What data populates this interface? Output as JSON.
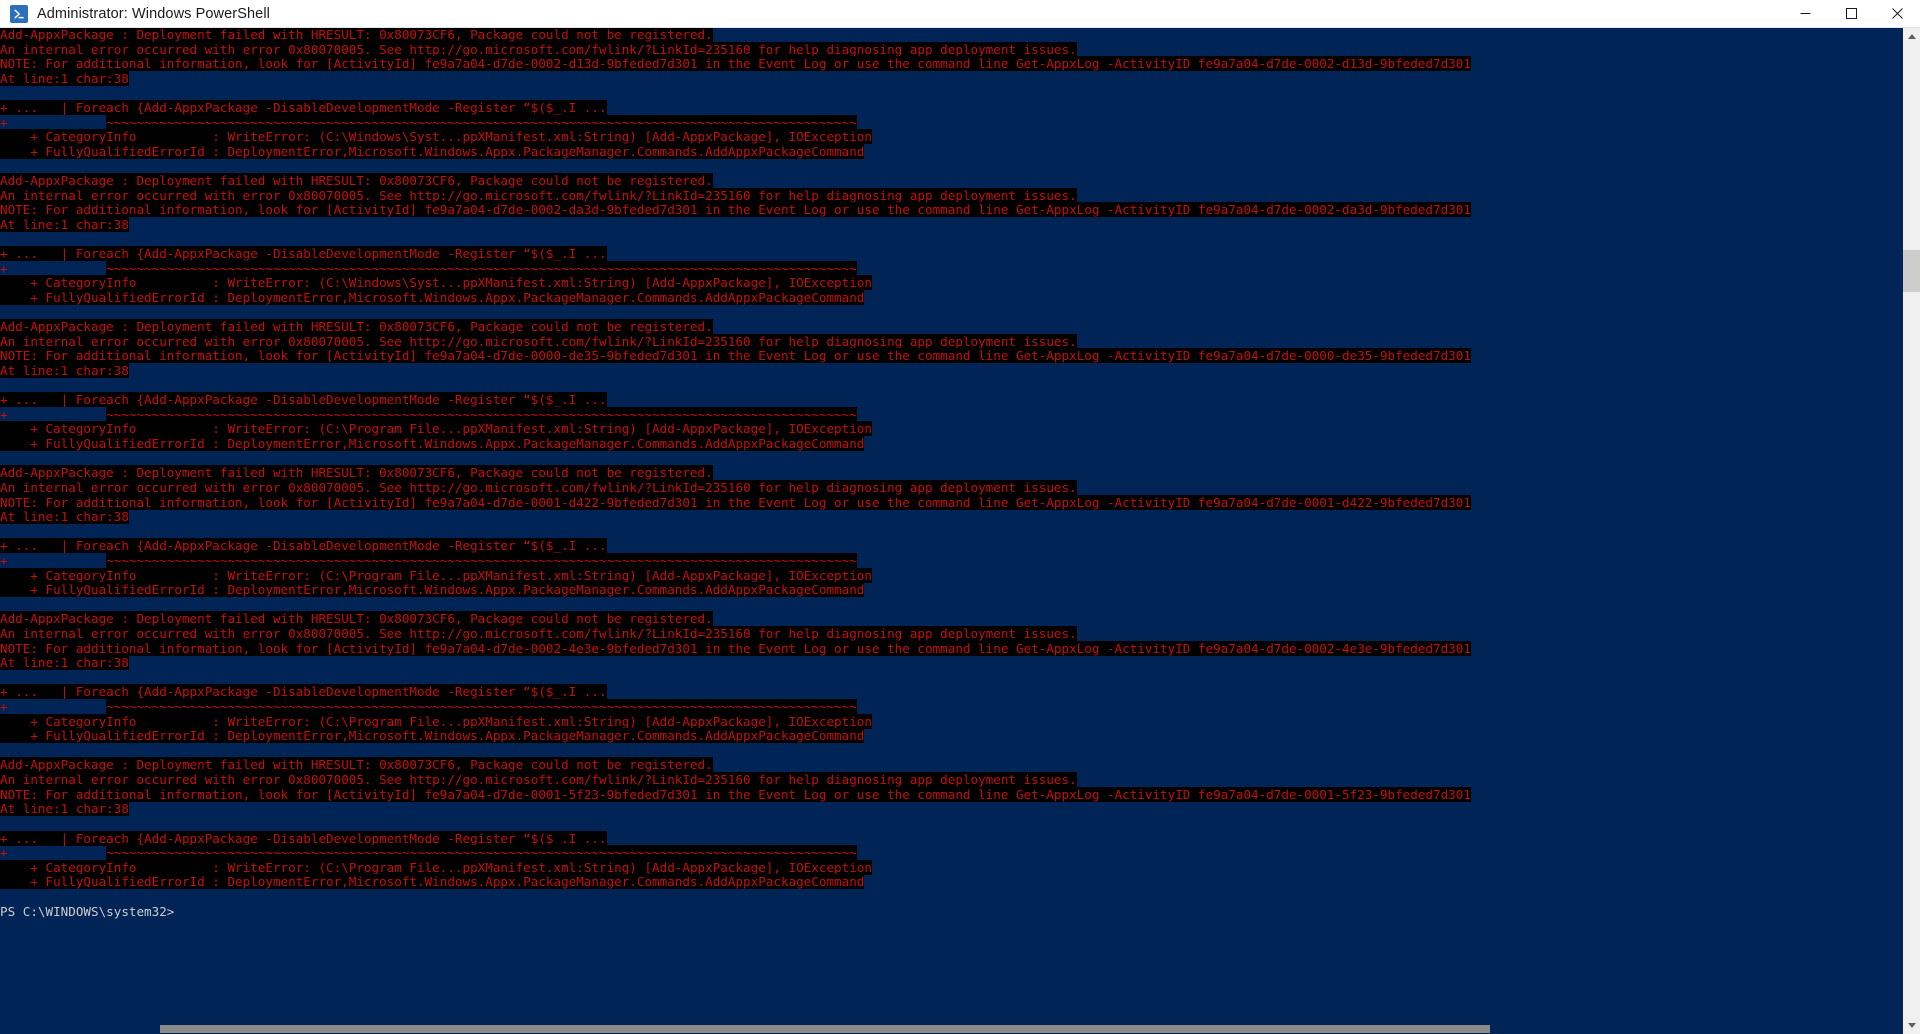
{
  "window": {
    "title": "Administrator: Windows PowerShell",
    "icon": "powershell-icon",
    "controls": {
      "minimize": "minimize-icon",
      "maximize": "maximize-icon",
      "close": "close-icon"
    }
  },
  "theme": {
    "console_bg": "#012456",
    "error_fg": "#c40f0f",
    "selection_bg": "#000000",
    "prompt_fg": "#cccccc",
    "titlebar_bg": "#ffffff",
    "titlebar_fg": "#1b1b1b",
    "scrollbar_track": "#f0f0f0",
    "scrollbar_thumb": "#cdcdcd"
  },
  "scrollbar": {
    "up_arrow": "scroll-up-icon",
    "down_arrow": "scroll-down-icon",
    "thumb": "scrollbar-thumb"
  },
  "console": {
    "prompt": "PS C:\\WINDOWS\\system32>",
    "error_blocks": [
      {
        "activity_id": "fe9a7a04-d7de-0002-d13d-9bfeded7d301",
        "path_fragment": "C:\\Windows\\Syst...ppXManifest.xml",
        "header": "Add-AppxPackage : Deployment failed with HRESULT: 0x80073CF6, Package could not be registered.",
        "internal": "An internal error occurred with error 0x80070005. See http://go.microsoft.com/fwlink/?LinkId=235160 for help diagnosing app deployment issues.",
        "note": "NOTE: For additional information, look for [ActivityId] fe9a7a04-d7de-0002-d13d-9bfeded7d301 in the Event Log or use the command line Get-AppxLog -ActivityID fe9a7a04-d7de-0002-d13d-9bfeded7d301",
        "at_line": "At line:1 char:38",
        "context": "+ ...   | Foreach {Add-AppxPackage -DisableDevelopmentMode -Register “$($_.I ...",
        "squiggle_pad": "+             ",
        "squiggle": "~~~~~~~~~~~~~~~~~~~~~~~~~~~~~~~~~~~~~~~~~~~~~~~~~~~~~~~~~~~~~~~~~~~~~~~~~~~~~~~~~~~~~~~~~~~~~~~~~~~",
        "category_info": "    + CategoryInfo          : WriteError: (C:\\Windows\\Syst...ppXManifest.xml:String) [Add-AppxPackage], IOException",
        "fq_error_id": "    + FullyQualifiedErrorId : DeploymentError,Microsoft.Windows.Appx.PackageManager.Commands.AddAppxPackageCommand"
      },
      {
        "activity_id": "fe9a7a04-d7de-0002-da3d-9bfeded7d301",
        "path_fragment": "C:\\Windows\\Syst...ppXManifest.xml",
        "header": "Add-AppxPackage : Deployment failed with HRESULT: 0x80073CF6, Package could not be registered.",
        "internal": "An internal error occurred with error 0x80070005. See http://go.microsoft.com/fwlink/?LinkId=235160 for help diagnosing app deployment issues.",
        "note": "NOTE: For additional information, look for [ActivityId] fe9a7a04-d7de-0002-da3d-9bfeded7d301 in the Event Log or use the command line Get-AppxLog -ActivityID fe9a7a04-d7de-0002-da3d-9bfeded7d301",
        "at_line": "At line:1 char:38",
        "context": "+ ...   | Foreach {Add-AppxPackage -DisableDevelopmentMode -Register “$($_.I ...",
        "squiggle_pad": "+             ",
        "squiggle": "~~~~~~~~~~~~~~~~~~~~~~~~~~~~~~~~~~~~~~~~~~~~~~~~~~~~~~~~~~~~~~~~~~~~~~~~~~~~~~~~~~~~~~~~~~~~~~~~~~~",
        "category_info": "    + CategoryInfo          : WriteError: (C:\\Windows\\Syst...ppXManifest.xml:String) [Add-AppxPackage], IOException",
        "fq_error_id": "    + FullyQualifiedErrorId : DeploymentError,Microsoft.Windows.Appx.PackageManager.Commands.AddAppxPackageCommand"
      },
      {
        "activity_id": "fe9a7a04-d7de-0000-de35-9bfeded7d301",
        "path_fragment": "C:\\Program File...ppXManifest.xml",
        "header": "Add-AppxPackage : Deployment failed with HRESULT: 0x80073CF6, Package could not be registered.",
        "internal": "An internal error occurred with error 0x80070005. See http://go.microsoft.com/fwlink/?LinkId=235160 for help diagnosing app deployment issues.",
        "note": "NOTE: For additional information, look for [ActivityId] fe9a7a04-d7de-0000-de35-9bfeded7d301 in the Event Log or use the command line Get-AppxLog -ActivityID fe9a7a04-d7de-0000-de35-9bfeded7d301",
        "at_line": "At line:1 char:38",
        "context": "+ ...   | Foreach {Add-AppxPackage -DisableDevelopmentMode -Register “$($_.I ...",
        "squiggle_pad": "+             ",
        "squiggle": "~~~~~~~~~~~~~~~~~~~~~~~~~~~~~~~~~~~~~~~~~~~~~~~~~~~~~~~~~~~~~~~~~~~~~~~~~~~~~~~~~~~~~~~~~~~~~~~~~~~",
        "category_info": "    + CategoryInfo          : WriteError: (C:\\Program File...ppXManifest.xml:String) [Add-AppxPackage], IOException",
        "fq_error_id": "    + FullyQualifiedErrorId : DeploymentError,Microsoft.Windows.Appx.PackageManager.Commands.AddAppxPackageCommand"
      },
      {
        "activity_id": "fe9a7a04-d7de-0001-d422-9bfeded7d301",
        "path_fragment": "C:\\Program File...ppXManifest.xml",
        "header": "Add-AppxPackage : Deployment failed with HRESULT: 0x80073CF6, Package could not be registered.",
        "internal": "An internal error occurred with error 0x80070005. See http://go.microsoft.com/fwlink/?LinkId=235160 for help diagnosing app deployment issues.",
        "note": "NOTE: For additional information, look for [ActivityId] fe9a7a04-d7de-0001-d422-9bfeded7d301 in the Event Log or use the command line Get-AppxLog -ActivityID fe9a7a04-d7de-0001-d422-9bfeded7d301",
        "at_line": "At line:1 char:38",
        "context": "+ ...   | Foreach {Add-AppxPackage -DisableDevelopmentMode -Register “$($_.I ...",
        "squiggle_pad": "+             ",
        "squiggle": "~~~~~~~~~~~~~~~~~~~~~~~~~~~~~~~~~~~~~~~~~~~~~~~~~~~~~~~~~~~~~~~~~~~~~~~~~~~~~~~~~~~~~~~~~~~~~~~~~~~",
        "category_info": "    + CategoryInfo          : WriteError: (C:\\Program File...ppXManifest.xml:String) [Add-AppxPackage], IOException",
        "fq_error_id": "    + FullyQualifiedErrorId : DeploymentError,Microsoft.Windows.Appx.PackageManager.Commands.AddAppxPackageCommand"
      },
      {
        "activity_id": "fe9a7a04-d7de-0002-4e3e-9bfeded7d301",
        "path_fragment": "C:\\Program File...ppXManifest.xml",
        "header": "Add-AppxPackage : Deployment failed with HRESULT: 0x80073CF6, Package could not be registered.",
        "internal": "An internal error occurred with error 0x80070005. See http://go.microsoft.com/fwlink/?LinkId=235160 for help diagnosing app deployment issues.",
        "note": "NOTE: For additional information, look for [ActivityId] fe9a7a04-d7de-0002-4e3e-9bfeded7d301 in the Event Log or use the command line Get-AppxLog -ActivityID fe9a7a04-d7de-0002-4e3e-9bfeded7d301",
        "at_line": "At line:1 char:38",
        "context": "+ ...   | Foreach {Add-AppxPackage -DisableDevelopmentMode -Register “$($_.I ...",
        "squiggle_pad": "+             ",
        "squiggle": "~~~~~~~~~~~~~~~~~~~~~~~~~~~~~~~~~~~~~~~~~~~~~~~~~~~~~~~~~~~~~~~~~~~~~~~~~~~~~~~~~~~~~~~~~~~~~~~~~~~",
        "category_info": "    + CategoryInfo          : WriteError: (C:\\Program File...ppXManifest.xml:String) [Add-AppxPackage], IOException",
        "fq_error_id": "    + FullyQualifiedErrorId : DeploymentError,Microsoft.Windows.Appx.PackageManager.Commands.AddAppxPackageCommand"
      },
      {
        "activity_id": "fe9a7a04-d7de-0001-5f23-9bfeded7d301",
        "path_fragment": "C:\\Program File...ppXManifest.xml",
        "header": "Add-AppxPackage : Deployment failed with HRESULT: 0x80073CF6, Package could not be registered.",
        "internal": "An internal error occurred with error 0x80070005. See http://go.microsoft.com/fwlink/?LinkId=235160 for help diagnosing app deployment issues.",
        "note": "NOTE: For additional information, look for [ActivityId] fe9a7a04-d7de-0001-5f23-9bfeded7d301 in the Event Log or use the command line Get-AppxLog -ActivityID fe9a7a04-d7de-0001-5f23-9bfeded7d301",
        "at_line": "At line:1 char:38",
        "context": "+ ...   | Foreach {Add-AppxPackage -DisableDevelopmentMode -Register “$($_.I ...",
        "squiggle_pad": "+             ",
        "squiggle": "~~~~~~~~~~~~~~~~~~~~~~~~~~~~~~~~~~~~~~~~~~~~~~~~~~~~~~~~~~~~~~~~~~~~~~~~~~~~~~~~~~~~~~~~~~~~~~~~~~~",
        "category_info": "    + CategoryInfo          : WriteError: (C:\\Program File...ppXManifest.xml:String) [Add-AppxPackage], IOException",
        "fq_error_id": "    + FullyQualifiedErrorId : DeploymentError,Microsoft.Windows.Appx.PackageManager.Commands.AddAppxPackageCommand"
      }
    ]
  }
}
